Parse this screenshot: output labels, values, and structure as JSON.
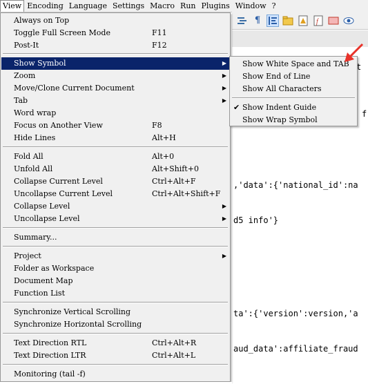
{
  "menubar": {
    "items": [
      "View",
      "Encoding",
      "Language",
      "Settings",
      "Macro",
      "Run",
      "Plugins",
      "Window",
      "?"
    ]
  },
  "toolbar": {
    "icons": [
      "indent-guide-icon",
      "pilcrow-icon",
      "indent-icon",
      "folder-workspace-icon",
      "doc-map-icon",
      "function-list-icon",
      "macro-record-icon",
      "monitor-eye-icon"
    ]
  },
  "editor": {
    "lines": [
      {
        "text": "t"
      },
      {
        "text": "f"
      },
      {
        "text": ",'data':{'national_id':na"
      },
      {
        "text": "d5 info'}"
      },
      {
        "text": "ta':{'version':version,'a"
      },
      {
        "text": "aud_data':affiliate_fraud"
      }
    ]
  },
  "view_menu": {
    "items": [
      {
        "label": "Always on Top",
        "shortcut": ""
      },
      {
        "label": "Toggle Full Screen Mode",
        "shortcut": "F11"
      },
      {
        "label": "Post-It",
        "shortcut": "F12"
      },
      {
        "label": "Show Symbol",
        "shortcut": ""
      },
      {
        "label": "Zoom",
        "shortcut": ""
      },
      {
        "label": "Move/Clone Current Document",
        "shortcut": ""
      },
      {
        "label": "Tab",
        "shortcut": ""
      },
      {
        "label": "Word wrap",
        "shortcut": ""
      },
      {
        "label": "Focus on Another View",
        "shortcut": "F8"
      },
      {
        "label": "Hide Lines",
        "shortcut": "Alt+H"
      },
      {
        "label": "Fold All",
        "shortcut": "Alt+0"
      },
      {
        "label": "Unfold All",
        "shortcut": "Alt+Shift+0"
      },
      {
        "label": "Collapse Current Level",
        "shortcut": "Ctrl+Alt+F"
      },
      {
        "label": "Uncollapse Current Level",
        "shortcut": "Ctrl+Alt+Shift+F"
      },
      {
        "label": "Collapse Level",
        "shortcut": ""
      },
      {
        "label": "Uncollapse Level",
        "shortcut": ""
      },
      {
        "label": "Summary...",
        "shortcut": ""
      },
      {
        "label": "Project",
        "shortcut": ""
      },
      {
        "label": "Folder as Workspace",
        "shortcut": ""
      },
      {
        "label": "Document Map",
        "shortcut": ""
      },
      {
        "label": "Function List",
        "shortcut": ""
      },
      {
        "label": "Synchronize Vertical Scrolling",
        "shortcut": ""
      },
      {
        "label": "Synchronize Horizontal Scrolling",
        "shortcut": ""
      },
      {
        "label": "Text Direction RTL",
        "shortcut": "Ctrl+Alt+R"
      },
      {
        "label": "Text Direction LTR",
        "shortcut": "Ctrl+Alt+L"
      },
      {
        "label": "Monitoring (tail -f)",
        "shortcut": ""
      }
    ]
  },
  "show_symbol_submenu": {
    "items": [
      {
        "label": "Show White Space and TAB"
      },
      {
        "label": "Show End of Line"
      },
      {
        "label": "Show All Characters"
      },
      {
        "label": "Show Indent Guide",
        "checked": true
      },
      {
        "label": "Show Wrap Symbol"
      }
    ]
  },
  "colors": {
    "highlight": "#0a246a",
    "menu_bg": "#f0f0f0",
    "annotation_arrow": "#e8322a"
  }
}
